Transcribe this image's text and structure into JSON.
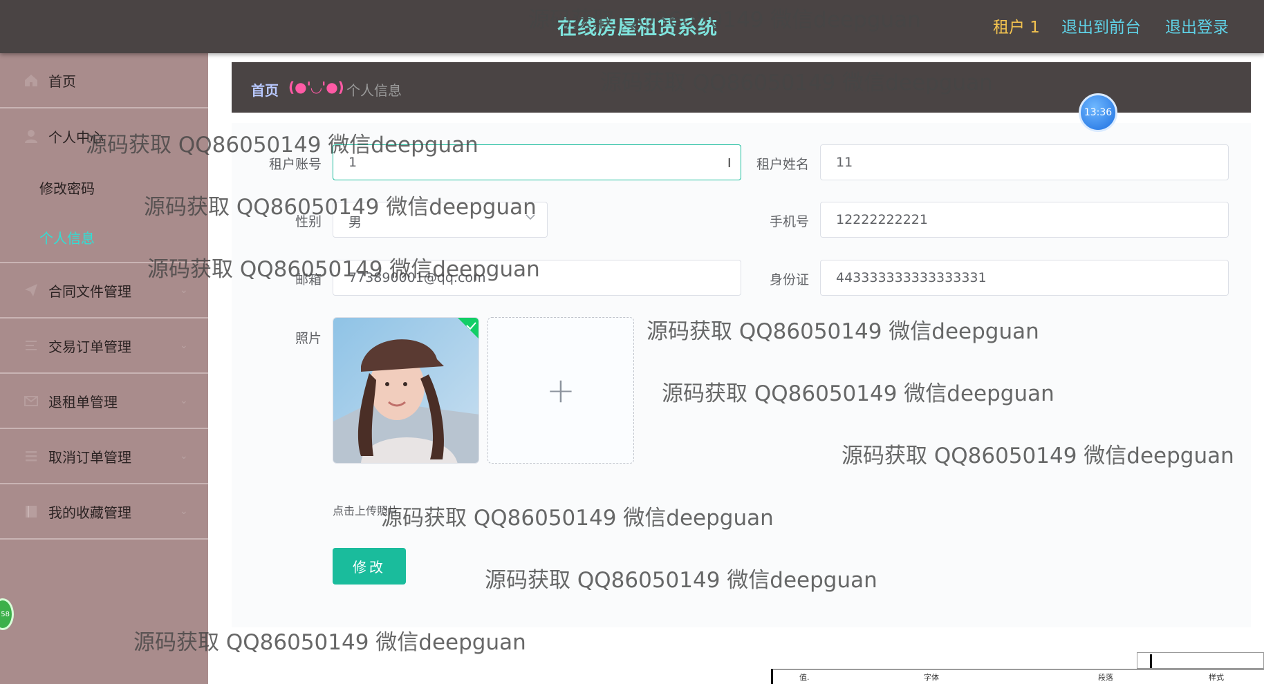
{
  "header": {
    "title": "在线房屋租赁系统",
    "user": "租户 1",
    "front_link": "退出到前台",
    "logout_link": "退出登录"
  },
  "sidebar": {
    "items": [
      {
        "label": "首页",
        "icon": "home-icon"
      },
      {
        "label": "个人中心",
        "icon": "user-icon"
      },
      {
        "label": "合同文件管理",
        "icon": "send-icon"
      },
      {
        "label": "交易订单管理",
        "icon": "list-icon"
      },
      {
        "label": "退租单管理",
        "icon": "mail-icon"
      },
      {
        "label": "取消订单管理",
        "icon": "menu-icon"
      },
      {
        "label": "我的收藏管理",
        "icon": "book-icon"
      }
    ],
    "sub_items": [
      {
        "label": "修改密码"
      },
      {
        "label": "个人信息",
        "active": true
      }
    ]
  },
  "breadcrumb": {
    "home": "首页",
    "separator": "(●'◡'●)",
    "current": "个人信息"
  },
  "clock": "13:36",
  "left_badge": "58",
  "form": {
    "account_label": "租户账号",
    "account_value": "1",
    "name_label": "租户姓名",
    "name_value": "11",
    "gender_label": "性别",
    "gender_value": "男",
    "phone_label": "手机号",
    "phone_value": "12222222221",
    "email_label": "邮箱",
    "email_value": "773890001@qq.com",
    "idcard_label": "身份证",
    "idcard_value": "443333333333333331",
    "photo_label": "照片",
    "upload_tip": "点击上传照片",
    "submit_label": "修改"
  },
  "watermark_text": "源码获取 QQ86050149 微信deepguan",
  "word_toolbar": {
    "labels": [
      "值.",
      "字体",
      "段落",
      "样式"
    ]
  },
  "colors": {
    "topbar": "#4a4444",
    "sidebar": "#a98c8c",
    "accent": "#1abc9c",
    "title": "#7fe3dc",
    "user": "#f2c24f",
    "links": "#5fd3e8",
    "active_sub": "#2fe0d6"
  }
}
